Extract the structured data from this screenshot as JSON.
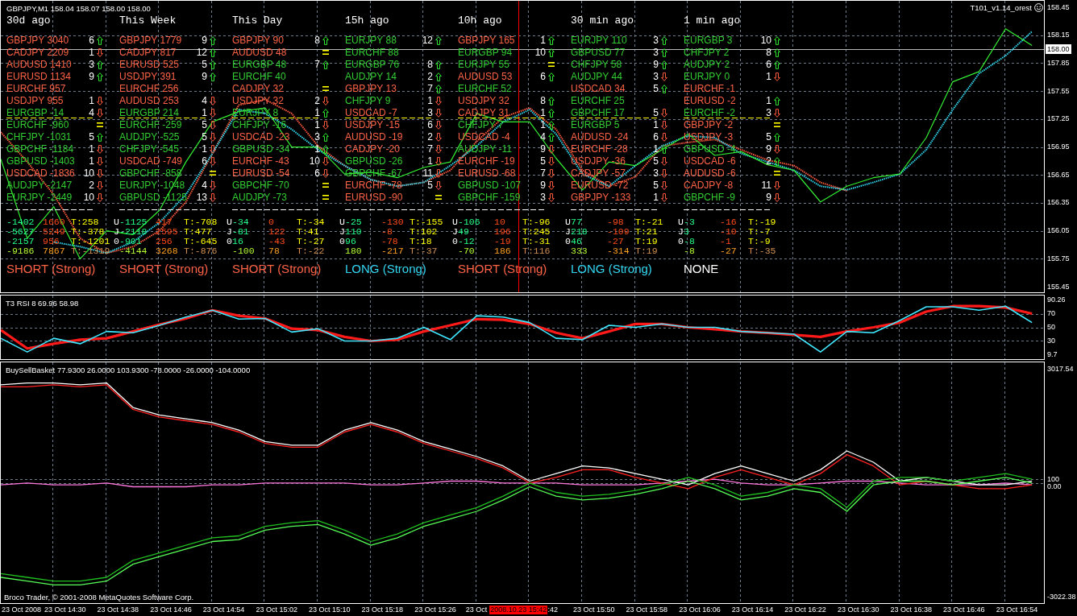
{
  "main_chart": {
    "legend": "GBPJPY,M1 158.04 158.07 158.00 158.00",
    "expert_label": "T101_v1.14_orest",
    "chart_data": {
      "type": "line",
      "grid": true,
      "ylim": [
        155.39,
        158.52
      ],
      "yticks": [
        {
          "value": 158.45,
          "label": "158.45"
        },
        {
          "value": 158.15,
          "label": "158.15"
        },
        {
          "value": 157.85,
          "label": "157.85"
        },
        {
          "value": 157.55,
          "label": "157.55"
        },
        {
          "value": 157.25,
          "label": "157.25"
        },
        {
          "value": 156.95,
          "label": "156.95"
        },
        {
          "value": 156.65,
          "label": "156.65"
        },
        {
          "value": 156.35,
          "label": "156.35"
        },
        {
          "value": 156.05,
          "label": "156.05"
        },
        {
          "value": 155.75,
          "label": "155.75"
        },
        {
          "value": 155.45,
          "label": "155.45"
        }
      ],
      "series": [
        {
          "line_style": "dashed",
          "color": "#ff5a3c",
          "values": [
            157.11,
            156.79,
            156.44,
            155.97,
            155.81,
            155.88,
            156.05,
            156.36,
            156.88,
            157.4,
            157.46,
            157.31,
            156.96,
            156.75,
            156.6,
            156.53,
            156.57,
            156.7,
            157.01,
            157.27,
            157.37,
            157.14,
            156.7,
            156.53,
            156.63,
            156.96,
            157.0,
            157.03,
            156.92,
            156.81,
            156.75,
            156.57,
            156.48,
            null,
            null,
            null,
            null,
            null,
            null,
            null
          ]
        },
        {
          "line_style": "dashed",
          "color": "#30d8f0",
          "values": [
            null,
            null,
            155.93,
            155.88,
            155.81,
            155.93,
            156.14,
            156.44,
            156.88,
            157.35,
            157.31,
            157.14,
            156.92,
            156.75,
            156.6,
            156.53,
            156.57,
            156.75,
            156.96,
            157.22,
            157.35,
            157.09,
            156.66,
            156.53,
            156.75,
            156.96,
            157.07,
            157.05,
            156.88,
            156.79,
            156.7,
            156.53,
            156.49,
            156.57,
            156.66,
            156.92,
            157.35,
            157.74,
            157.93,
            158.19
          ]
        },
        {
          "line_style": "solid",
          "color": "#33ee33",
          "values": [
            156.82,
            155.97,
            156.31,
            155.75,
            156.05,
            156.01,
            156.27,
            156.79,
            157.22,
            157.33,
            157.37,
            156.95,
            156.95,
            156.66,
            156.68,
            156.62,
            156.73,
            156.79,
            157.31,
            157.22,
            157.22,
            156.83,
            156.49,
            156.79,
            156.75,
            156.92,
            157.09,
            156.86,
            156.9,
            156.76,
            156.7,
            156.36,
            156.53,
            156.62,
            156.66,
            157.05,
            157.65,
            157.76,
            158.22,
            158.04
          ]
        }
      ],
      "ref_lines": [
        {
          "axis": "y",
          "value": 158.0,
          "label": "158.00",
          "color": "#b8b8b8"
        }
      ]
    }
  },
  "strength_table": {
    "columns": [
      {
        "title": "30d ago",
        "rows": [
          {
            "text": "GBPJPY 3040",
            "count": "6",
            "kind": "up",
            "color": "#ff6347"
          },
          {
            "text": "CADJPY 2209",
            "count": "1",
            "kind": "down",
            "color": "#ff6347"
          },
          {
            "text": "AUDUSD 1410",
            "count": "3",
            "kind": "up",
            "color": "#ff6347"
          },
          {
            "text": "EURUSD 1134",
            "count": "9",
            "kind": "up",
            "color": "#ff6347"
          },
          {
            "text": "EURCHF 957",
            "kind": "plain",
            "color": "#ff6347"
          },
          {
            "text": "USDJPY 955",
            "count": "1",
            "kind": "down",
            "color": "#ff6347"
          },
          {
            "text": "EURGBP -14",
            "count": "4",
            "kind": "down",
            "color": "#32cd32"
          },
          {
            "text": "EURCHF -960",
            "kind": "flat",
            "color": "#32cd32"
          },
          {
            "text": "CHFJPY -1031",
            "count": "5",
            "kind": "up",
            "color": "#32cd32"
          },
          {
            "text": "GBPCHF -1184",
            "count": "1",
            "kind": "down",
            "color": "#32cd32"
          },
          {
            "text": "GBPUSD -1403",
            "count": "1",
            "kind": "down",
            "color": "#32cd32"
          },
          {
            "text": "USDCAD -1836",
            "count": "10",
            "kind": "down",
            "color": "#ff6347"
          },
          {
            "text": "AUDJPY -2147",
            "count": "2",
            "kind": "down",
            "color": "#32cd32"
          },
          {
            "text": "EURJPY -2449",
            "count": "10",
            "kind": "down",
            "color": "#32cd32"
          }
        ],
        "totals": [
          {
            "kind": "partial",
            "first": "-1402",
            "second": "1660",
            "total": "T:258"
          },
          {
            "kind": "partial",
            "first": "-5627",
            "second": "5249",
            "total": "T:-378"
          },
          {
            "kind": "partial",
            "first": "-2157",
            "second": "956",
            "total": "T:-1201"
          },
          {
            "kind": "sum",
            "first": "-9186",
            "second": "7867",
            "total": "T:-1319"
          }
        ],
        "signal": {
          "text": "SHORT (Strong)",
          "kind": "short"
        }
      },
      {
        "title": "This Week",
        "rows": [
          {
            "text": "GBPJPY 1779",
            "count": "9",
            "kind": "up",
            "color": "#ff6347"
          },
          {
            "text": "CADJPY 817",
            "count": "12",
            "kind": "up",
            "color": "#ff6347"
          },
          {
            "text": "EURUSD 525",
            "count": "5",
            "kind": "up",
            "color": "#ff6347"
          },
          {
            "text": "USDJPY 391",
            "count": "9",
            "kind": "up",
            "color": "#ff6347"
          },
          {
            "text": "EURCHF 256",
            "kind": "plain",
            "color": "#ff6347"
          },
          {
            "text": "AUDUSD 253",
            "count": "4",
            "kind": "down",
            "color": "#ff6347"
          },
          {
            "text": "EURGBP 214",
            "count": "1",
            "kind": "down",
            "color": "#32cd32"
          },
          {
            "text": "EURCHF -259",
            "count": "5",
            "kind": "down",
            "color": "#32cd32"
          },
          {
            "text": "AUDJPY -525",
            "count": "5",
            "kind": "down",
            "color": "#32cd32"
          },
          {
            "text": "CHFJPY -545",
            "count": "1",
            "kind": "down",
            "color": "#32cd32"
          },
          {
            "text": "USDCAD -749",
            "count": "6",
            "kind": "down",
            "color": "#ff6347"
          },
          {
            "text": "GBPCHF -858",
            "kind": "flat",
            "color": "#32cd32"
          },
          {
            "text": "EURJPY -1048",
            "count": "4",
            "kind": "down",
            "color": "#32cd32"
          },
          {
            "text": "GBPUSD -1125",
            "count": "13",
            "kind": "down",
            "color": "#32cd32"
          }
        ],
        "totals": [
          {
            "kind": "partial",
            "tag": "U",
            "first": "-1125",
            "second": "417",
            "total": "T:-708"
          },
          {
            "kind": "partial",
            "tag": "J",
            "first": "-2118",
            "second": "2595",
            "total": "T:477"
          },
          {
            "kind": "partial",
            "tag": "0",
            "first": "-901",
            "second": "256",
            "total": "T:-645"
          },
          {
            "kind": "sum",
            "first": "-4144",
            "second": "3268",
            "total": "T:-876"
          }
        ],
        "signal": {
          "text": "SHORT (Strong)",
          "kind": "short"
        }
      },
      {
        "title": "This Day",
        "rows": [
          {
            "text": "GBPJPY 90",
            "count": "8",
            "kind": "up",
            "color": "#ff6347"
          },
          {
            "text": "AUDUSD 48",
            "kind": "flat",
            "color": "#ff6347"
          },
          {
            "text": "EURGBP 48",
            "count": "7",
            "kind": "up",
            "color": "#32cd32"
          },
          {
            "text": "EURCHF 40",
            "kind": "plain",
            "color": "#32cd32"
          },
          {
            "text": "CADJPY 32",
            "kind": "flat",
            "color": "#ff6347"
          },
          {
            "text": "USDJPY 32",
            "count": "2",
            "kind": "down",
            "color": "#ff6347"
          },
          {
            "text": "EURJPY 8",
            "count": "1",
            "kind": "up",
            "color": "#32cd32"
          },
          {
            "text": "CHFJPY -16",
            "count": "1",
            "kind": "down",
            "color": "#32cd32"
          },
          {
            "text": "USDCAD -23",
            "count": "3",
            "kind": "up",
            "color": "#ff6347"
          },
          {
            "text": "GBPUSD -34",
            "count": "1",
            "kind": "up",
            "color": "#32cd32"
          },
          {
            "text": "EURCHF -43",
            "count": "10",
            "kind": "down",
            "color": "#ff6347"
          },
          {
            "text": "EURUSD -54",
            "count": "6",
            "kind": "down",
            "color": "#ff6347"
          },
          {
            "text": "GBPCHF -70",
            "kind": "flat",
            "color": "#32cd32"
          },
          {
            "text": "AUDJPY -73",
            "kind": "flat",
            "color": "#32cd32"
          }
        ],
        "totals": [
          {
            "kind": "partial",
            "tag": "U",
            "first": "-34",
            "second": "0",
            "total": "T:-34"
          },
          {
            "kind": "partial",
            "tag": "J",
            "first": "-81",
            "second": "122",
            "total": "T:41"
          },
          {
            "kind": "partial",
            "tag": "0",
            "first": "16",
            "second": "-43",
            "total": "T:-27"
          },
          {
            "kind": "sum",
            "first": "-100",
            "second": "78",
            "total": "T:-22"
          }
        ],
        "signal": {
          "text": "SHORT (Strong)",
          "kind": "short"
        }
      },
      {
        "title": "15h ago",
        "rows": [
          {
            "text": "EURJPY 88",
            "count": "12",
            "kind": "up",
            "color": "#32cd32"
          },
          {
            "text": "EURCHF 88",
            "kind": "plain",
            "color": "#32cd32"
          },
          {
            "text": "EURGBP 76",
            "count": "8",
            "kind": "up",
            "color": "#32cd32"
          },
          {
            "text": "AUDJPY 14",
            "count": "2",
            "kind": "up",
            "color": "#32cd32"
          },
          {
            "text": "GBPJPY 13",
            "count": "7",
            "kind": "up",
            "color": "#ff6347"
          },
          {
            "text": "CHFJPY 9",
            "count": "1",
            "kind": "down",
            "color": "#32cd32"
          },
          {
            "text": "USDCAD -7",
            "count": "3",
            "kind": "down",
            "color": "#ff6347"
          },
          {
            "text": "USDJPY -15",
            "count": "6",
            "kind": "down",
            "color": "#ff6347"
          },
          {
            "text": "AUDUSD -19",
            "count": "2",
            "kind": "down",
            "color": "#ff6347"
          },
          {
            "text": "CADJPY -20",
            "count": "7",
            "kind": "down",
            "color": "#ff6347"
          },
          {
            "text": "GBPUSD -26",
            "count": "1",
            "kind": "down",
            "color": "#32cd32"
          },
          {
            "text": "GBPCHF -67",
            "count": "11",
            "kind": "down",
            "color": "#32cd32"
          },
          {
            "text": "EURCHF -78",
            "count": "5",
            "kind": "down",
            "color": "#ff6347"
          },
          {
            "text": "EURUSD -90",
            "kind": "flat",
            "color": "#ff6347"
          }
        ],
        "totals": [
          {
            "kind": "partial",
            "tag": "U",
            "first": "-25",
            "second": "-130",
            "total": "T:-155"
          },
          {
            "kind": "partial",
            "tag": "J",
            "first": "110",
            "second": "-8",
            "total": "T:102"
          },
          {
            "kind": "partial",
            "tag": "0",
            "first": "96",
            "second": "-78",
            "total": "T:18"
          },
          {
            "kind": "sum",
            "first": "180",
            "second": "-217",
            "total": "T:-37"
          }
        ],
        "signal": {
          "text": "LONG (Strong)",
          "kind": "long"
        }
      },
      {
        "title": "10h ago",
        "rows": [
          {
            "text": "GBPJPY 165",
            "count": "1",
            "kind": "up",
            "color": "#ff6347"
          },
          {
            "text": "EURGBP 94",
            "count": "10",
            "kind": "up",
            "color": "#32cd32"
          },
          {
            "text": "EURJPY 55",
            "kind": "flat",
            "color": "#32cd32"
          },
          {
            "text": "AUDUSD 53",
            "count": "6",
            "kind": "up",
            "color": "#ff6347"
          },
          {
            "text": "EURCHF 52",
            "kind": "plain",
            "color": "#32cd32"
          },
          {
            "text": "USDJPY 32",
            "count": "8",
            "kind": "up",
            "color": "#ff6347"
          },
          {
            "text": "CADJPY 31",
            "count": "1",
            "kind": "up",
            "color": "#ff6347"
          },
          {
            "text": "CHFJPY 7",
            "count": "1",
            "kind": "up",
            "color": "#32cd32"
          },
          {
            "text": "USDCAD -4",
            "count": "4",
            "kind": "up",
            "color": "#ff6347"
          },
          {
            "text": "AUDJPY -11",
            "count": "9",
            "kind": "down",
            "color": "#32cd32"
          },
          {
            "text": "EURCHF -19",
            "count": "5",
            "kind": "down",
            "color": "#ff6347"
          },
          {
            "text": "EURUSD -68",
            "count": "7",
            "kind": "down",
            "color": "#ff6347"
          },
          {
            "text": "GBPUSD -107",
            "count": "9",
            "kind": "down",
            "color": "#32cd32"
          },
          {
            "text": "GBPCHF -159",
            "count": "3",
            "kind": "down",
            "color": "#32cd32"
          }
        ],
        "totals": [
          {
            "kind": "partial",
            "tag": "U",
            "first": "-106",
            "second": "10",
            "total": "T:-96"
          },
          {
            "kind": "partial",
            "tag": "J",
            "first": "49",
            "second": "196",
            "total": "T:245"
          },
          {
            "kind": "partial",
            "tag": "0",
            "first": "-12",
            "second": "-19",
            "total": "T:-31"
          },
          {
            "kind": "sum",
            "first": "-70",
            "second": "186",
            "total": "T:116"
          }
        ],
        "signal": {
          "text": "SHORT (Strong)",
          "kind": "short"
        }
      },
      {
        "title": "30 min ago",
        "rows": [
          {
            "text": "EURJPY 110",
            "count": "3",
            "kind": "up",
            "color": "#32cd32"
          },
          {
            "text": "GBPUSD 77",
            "count": "3",
            "kind": "up",
            "color": "#32cd32"
          },
          {
            "text": "CHFJPY 58",
            "count": "9",
            "kind": "up",
            "color": "#32cd32"
          },
          {
            "text": "AUDJPY 44",
            "count": "3",
            "kind": "down",
            "color": "#32cd32"
          },
          {
            "text": "USDCAD 34",
            "count": "5",
            "kind": "up",
            "color": "#ff6347"
          },
          {
            "text": "EURCHF 25",
            "kind": "plain",
            "color": "#32cd32"
          },
          {
            "text": "GBPCHF 17",
            "count": "5",
            "kind": "down",
            "color": "#32cd32"
          },
          {
            "text": "EURGBP 5",
            "count": "1",
            "kind": "down",
            "color": "#32cd32"
          },
          {
            "text": "AUDUSD -24",
            "count": "6",
            "kind": "down",
            "color": "#ff6347"
          },
          {
            "text": "EURCHF -28",
            "count": "1",
            "kind": "up",
            "color": "#ff6347"
          },
          {
            "text": "USDJPY -36",
            "count": "5",
            "kind": "down",
            "color": "#ff6347"
          },
          {
            "text": "CADJPY -57",
            "count": "3",
            "kind": "down",
            "color": "#ff6347"
          },
          {
            "text": "EURUSD -72",
            "count": "5",
            "kind": "down",
            "color": "#ff6347"
          },
          {
            "text": "GBPJPY -133",
            "count": "1",
            "kind": "down",
            "color": "#ff6347"
          }
        ],
        "totals": [
          {
            "kind": "partial",
            "tag": "U",
            "first": "77",
            "second": "-98",
            "total": "T:-21"
          },
          {
            "kind": "partial",
            "tag": "J",
            "first": "218",
            "second": "-109",
            "total": "T:21"
          },
          {
            "kind": "partial",
            "tag": "0",
            "first": "46",
            "second": "-27",
            "total": "T:19"
          },
          {
            "kind": "sum",
            "first": "333",
            "second": "-314",
            "total": "T:19"
          }
        ],
        "signal": {
          "text": "LONG (Strong)",
          "kind": "long"
        }
      },
      {
        "title": "1 min ago",
        "rows": [
          {
            "text": "EURGBP 3",
            "count": "10",
            "kind": "up",
            "color": "#32cd32"
          },
          {
            "text": "CHFJPY 2",
            "count": "8",
            "kind": "up",
            "color": "#32cd32"
          },
          {
            "text": "AUDJPY 2",
            "count": "6",
            "kind": "up",
            "color": "#32cd32"
          },
          {
            "text": "EURJPY 0",
            "count": "1",
            "kind": "down",
            "color": "#32cd32"
          },
          {
            "text": "EURCHF -1",
            "kind": "plain",
            "color": "#ff6347"
          },
          {
            "text": "EURUSD -2",
            "count": "1",
            "kind": "up",
            "color": "#ff6347"
          },
          {
            "text": "EURCHF -2",
            "count": "3",
            "kind": "down",
            "color": "#32cd32"
          },
          {
            "text": "GBPJPY -2",
            "kind": "flat",
            "color": "#ff6347"
          },
          {
            "text": "USDJPY -3",
            "count": "5",
            "kind": "up",
            "color": "#ff6347"
          },
          {
            "text": "GBPUSD -4",
            "count": "9",
            "kind": "down",
            "color": "#32cd32"
          },
          {
            "text": "USDCAD -6",
            "count": "2",
            "kind": "up",
            "color": "#ff6347"
          },
          {
            "text": "AUDUSD -6",
            "kind": "flat",
            "color": "#ff6347"
          },
          {
            "text": "CADJPY -8",
            "count": "11",
            "kind": "down",
            "color": "#ff6347"
          },
          {
            "text": "GBPCHF -9",
            "count": "9",
            "kind": "down",
            "color": "#32cd32"
          }
        ],
        "totals": [
          {
            "kind": "partial",
            "tag": "U",
            "first": "-3",
            "second": "-16",
            "total": "T:-19"
          },
          {
            "kind": "partial",
            "tag": "J",
            "first": "3",
            "second": "-10",
            "total": "T:-7"
          },
          {
            "kind": "partial",
            "tag": "0",
            "first": "-8",
            "second": "-1",
            "total": "T:-9"
          },
          {
            "kind": "sum",
            "first": "-8",
            "second": "-27",
            "total": "T:-35"
          }
        ],
        "signal": {
          "text": "NONE",
          "kind": "none"
        }
      }
    ]
  },
  "rsi_panel": {
    "legend": "T3 RSI 8 69.96 58.98",
    "chart_data": {
      "type": "line",
      "grid": true,
      "ylim": [
        3.5,
        96.5
      ],
      "yticks": [
        {
          "value": 90.26,
          "label": "90.26"
        },
        {
          "value": 70,
          "label": "70"
        },
        {
          "value": 50,
          "label": "50"
        },
        {
          "value": 30,
          "label": "30"
        },
        {
          "value": 9.7,
          "label": "9.7"
        }
      ],
      "series": [
        {
          "line_style": "solid",
          "color": "#ff1a1a",
          "values": [
            46,
            19,
            26,
            32,
            34,
            44,
            54,
            63,
            75,
            67,
            63,
            48,
            46,
            36,
            30,
            32,
            44,
            53,
            62,
            61,
            55,
            42,
            34,
            44,
            55,
            55,
            50,
            47,
            44,
            42,
            39,
            36,
            44,
            50,
            57,
            73,
            81,
            81,
            79,
            70
          ]
        },
        {
          "line_style": "solid",
          "color": "#40e8ff",
          "values": [
            34,
            14,
            34,
            26,
            44,
            42,
            53,
            65,
            75,
            62,
            63,
            43,
            48,
            30,
            30,
            34,
            50,
            32,
            67,
            65,
            57,
            34,
            32,
            53,
            50,
            55,
            50,
            50,
            44,
            42,
            40,
            14,
            44,
            42,
            60,
            80,
            80,
            75,
            81,
            57
          ]
        }
      ]
    }
  },
  "basket_panel": {
    "legend": "BuySellBasket 77.9300 26.0000 103.9300 -78.0000 -26.0000 -104.0000",
    "footer": "Broco Trader, © 2001-2008 MetaQuotes Software Corp.",
    "chart_data": {
      "type": "line",
      "grid": true,
      "ylim": [
        -3182,
        3196
      ],
      "yticks": [
        {
          "value": 3017.543,
          "label": "3017.54"
        },
        {
          "value": 100,
          "label": "100"
        },
        {
          "value": 0,
          "label": "0.00"
        },
        {
          "value": -3022.38,
          "label": "-3022.38"
        }
      ],
      "series": [
        {
          "line_style": "solid",
          "color": "#ff77dd",
          "values": [
            -50,
            0,
            -50,
            -50,
            0,
            -100,
            -100,
            -100,
            -50,
            -50,
            0,
            0,
            0,
            0,
            -50,
            -50,
            0,
            50,
            50,
            0,
            0,
            0,
            -50,
            -50,
            -50,
            0,
            50,
            100,
            0,
            -50,
            -50,
            0,
            50,
            50,
            0,
            -50,
            -50,
            -50,
            0,
            -50
          ]
        },
        {
          "line_style": "solid",
          "color": "#ff2222",
          "values": [
            2550,
            2550,
            2600,
            2550,
            2600,
            1950,
            1750,
            1650,
            1550,
            1350,
            1050,
            950,
            950,
            1350,
            1550,
            1350,
            1050,
            850,
            650,
            400,
            0,
            150,
            350,
            350,
            150,
            0,
            -150,
            150,
            350,
            150,
            -50,
            250,
            750,
            450,
            -50,
            50,
            -50,
            -150,
            -150,
            -50
          ]
        },
        {
          "line_style": "solid",
          "color": "#ffffff",
          "values": [
            2600,
            2650,
            2650,
            2600,
            2650,
            2000,
            1800,
            1700,
            1600,
            1400,
            1100,
            1000,
            1000,
            1400,
            1600,
            1400,
            1100,
            900,
            700,
            450,
            50,
            250,
            450,
            400,
            250,
            100,
            -50,
            250,
            450,
            250,
            50,
            350,
            850,
            550,
            50,
            150,
            50,
            -50,
            -50,
            50
          ]
        },
        {
          "line_style": "solid",
          "color": "#1fbf1f",
          "values": [
            -2400,
            -2500,
            -2600,
            -2600,
            -2500,
            -2050,
            -1850,
            -1650,
            -1450,
            -1400,
            -1150,
            -1050,
            -1000,
            -1250,
            -1550,
            -1350,
            -1050,
            -850,
            -650,
            -350,
            0,
            -250,
            -350,
            -300,
            -200,
            -50,
            150,
            -50,
            -350,
            -250,
            -50,
            -150,
            -650,
            50,
            150,
            150,
            50,
            150,
            250,
            100
          ]
        },
        {
          "line_style": "solid",
          "color": "#55ff55",
          "values": [
            -2500,
            -2600,
            -2700,
            -2700,
            -2600,
            -2150,
            -1950,
            -1750,
            -1550,
            -1500,
            -1250,
            -1150,
            -1100,
            -1350,
            -1650,
            -1450,
            -1150,
            -950,
            -750,
            -450,
            -100,
            -350,
            -450,
            -400,
            -300,
            -150,
            50,
            -150,
            -450,
            -350,
            -150,
            -250,
            -750,
            -50,
            50,
            50,
            -50,
            50,
            150,
            0
          ]
        }
      ]
    }
  },
  "time_axis": {
    "labels": [
      {
        "text": "23 Oct 2008",
        "kind": "date"
      },
      {
        "text": "23 Oct 14:30",
        "kind": "tick"
      },
      {
        "text": "23 Oct 14:38",
        "kind": "tick"
      },
      {
        "text": "23 Oct 14:46",
        "kind": "tick"
      },
      {
        "text": "23 Oct 14:54",
        "kind": "tick"
      },
      {
        "text": "23 Oct 15:02",
        "kind": "tick"
      },
      {
        "text": "23 Oct 15:10",
        "kind": "tick"
      },
      {
        "text": "23 Oct 15:18",
        "kind": "tick"
      },
      {
        "text": "23 Oct 15:26",
        "kind": "tick"
      },
      {
        "text": "23 Oct",
        "kind": "cut"
      },
      {
        "text": "2008.10.23 15:42",
        "kind": "cursor"
      },
      {
        "text": ":42",
        "kind": "cut"
      },
      {
        "text": "23 Oct 15:50",
        "kind": "tick"
      },
      {
        "text": "23 Oct 15:58",
        "kind": "tick"
      },
      {
        "text": "23 Oct 16:06",
        "kind": "tick"
      },
      {
        "text": "23 Oct 16:14",
        "kind": "tick"
      },
      {
        "text": "23 Oct 16:22",
        "kind": "tick"
      },
      {
        "text": "23 Oct 16:30",
        "kind": "tick"
      },
      {
        "text": "23 Oct 16:38",
        "kind": "tick"
      },
      {
        "text": "23 Oct 16:46",
        "kind": "tick"
      },
      {
        "text": "23 Oct 16:54",
        "kind": "tick"
      }
    ]
  }
}
